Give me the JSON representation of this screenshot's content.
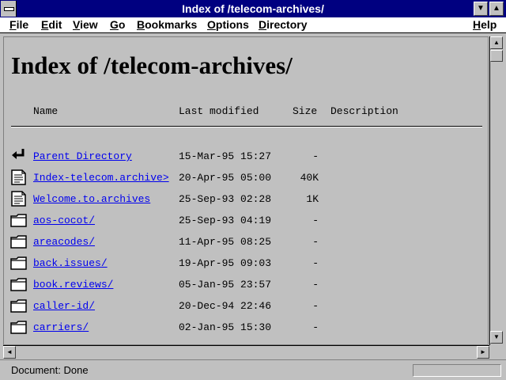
{
  "window": {
    "title": "Index of /telecom-archives/"
  },
  "menu": {
    "items": [
      {
        "label": "File",
        "u": "F",
        "rest": "ile"
      },
      {
        "label": "Edit",
        "u": "E",
        "rest": "dit"
      },
      {
        "label": "View",
        "u": "V",
        "rest": "iew"
      },
      {
        "label": "Go",
        "u": "G",
        "rest": "o"
      },
      {
        "label": "Bookmarks",
        "u": "B",
        "rest": "ookmarks"
      },
      {
        "label": "Options",
        "u": "O",
        "rest": "ptions"
      },
      {
        "label": "Directory",
        "u": "D",
        "rest": "irectory"
      },
      {
        "label": "Help",
        "u": "H",
        "rest": "elp"
      }
    ]
  },
  "page": {
    "heading": "Index of /telecom-archives/",
    "columns": {
      "name": "Name",
      "modified": "Last modified",
      "size": "Size",
      "description": "Description"
    },
    "rows": [
      {
        "icon": "back-arrow-icon",
        "name": "Parent Directory",
        "modified": "15-Mar-95 15:27",
        "size": "-"
      },
      {
        "icon": "text-file-icon",
        "name": "Index-telecom.archive>",
        "modified": "20-Apr-95 05:00",
        "size": "40K"
      },
      {
        "icon": "text-file-icon",
        "name": "Welcome.to.archives",
        "modified": "25-Sep-93 02:28",
        "size": "1K"
      },
      {
        "icon": "folder-icon",
        "name": "aos-cocot/",
        "modified": "25-Sep-93 04:19",
        "size": "-"
      },
      {
        "icon": "folder-icon",
        "name": "areacodes/",
        "modified": "11-Apr-95 08:25",
        "size": "-"
      },
      {
        "icon": "folder-icon",
        "name": "back.issues/",
        "modified": "19-Apr-95 09:03",
        "size": "-"
      },
      {
        "icon": "folder-icon",
        "name": "book.reviews/",
        "modified": "05-Jan-95 23:57",
        "size": "-"
      },
      {
        "icon": "folder-icon",
        "name": "caller-id/",
        "modified": "20-Dec-94 22:46",
        "size": "-"
      },
      {
        "icon": "folder-icon",
        "name": "carriers/",
        "modified": "02-Jan-95 15:30",
        "size": "-"
      }
    ]
  },
  "status": {
    "text": "Document: Done"
  }
}
